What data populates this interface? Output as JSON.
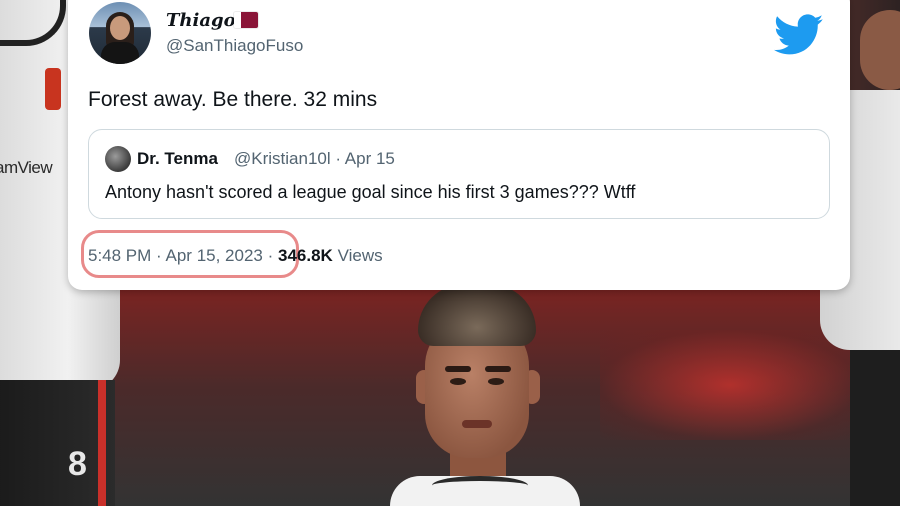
{
  "tweet": {
    "display_name": "Thiago",
    "handle": "@SanThiagoFuso",
    "text": "Forest away. Be there. 32 mins",
    "time": "5:48 PM",
    "separator": "·",
    "date": "Apr 15, 2023",
    "views_count": "346.8K",
    "views_label": "Views"
  },
  "quoted_tweet": {
    "display_name": "Dr. Tenma",
    "handle_date": "@Kristian10l · Apr 15",
    "text": "Antony hasn't scored a league goal since his first 3 games??? Wtff"
  },
  "background": {
    "left_shirt_sponsor": "amView",
    "left_shorts_number": "8"
  },
  "icons": {
    "brand": "twitter-bird-icon",
    "flag": "qatar-flag-icon"
  },
  "colors": {
    "twitter_blue": "#1d9bf0",
    "highlight": "#e88a8a",
    "secondary_text": "#536471"
  }
}
